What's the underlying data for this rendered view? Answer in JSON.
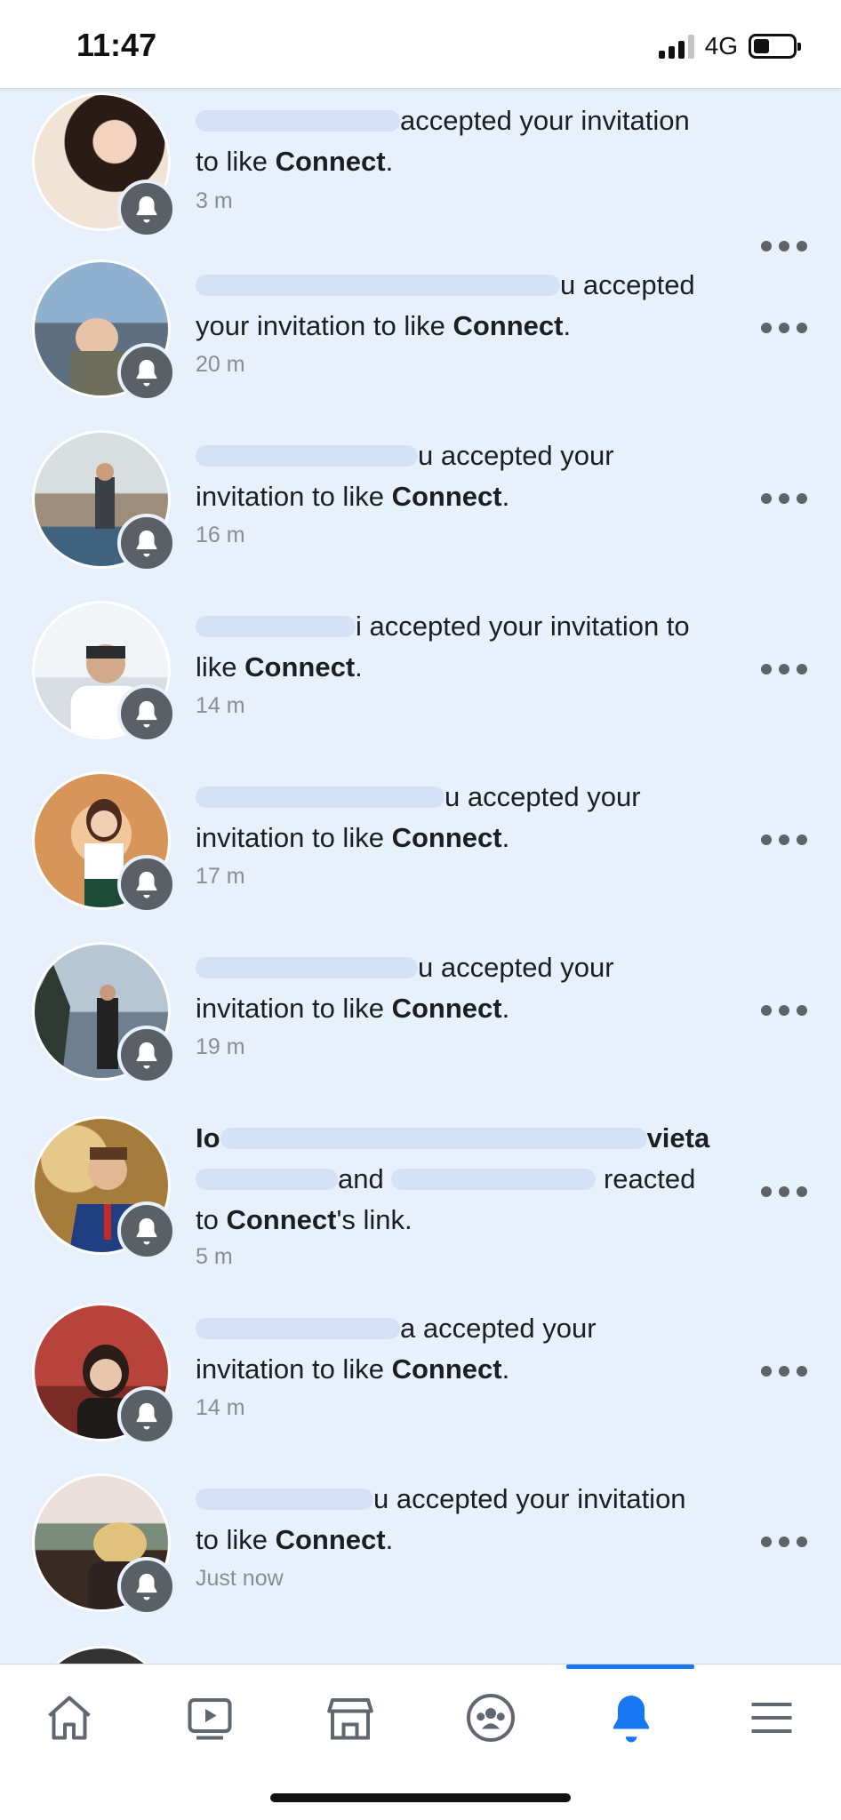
{
  "status_bar": {
    "time": "11:47",
    "network": "4G",
    "signal_bars_active": 3,
    "battery_level": 0.4
  },
  "notifications": [
    {
      "text": "accepted your invitation to like",
      "page": "Connect",
      "suffix": ".",
      "time": "3 m",
      "avatar_bg": [
        "#f3b39c",
        "#2b1b16"
      ]
    },
    {
      "text": "accepted your invitation to like",
      "page": "Connect",
      "suffix": ".",
      "time": "20 m",
      "avatar_bg": [
        "#6f93b3",
        "#3c5366"
      ]
    },
    {
      "text": "accepted your invitation to like",
      "page": "Connect",
      "suffix": ".",
      "time": "16 m",
      "avatar_bg": [
        "#c9d3d8",
        "#7a6a58"
      ]
    },
    {
      "text": "accepted your invitation to",
      "page": "Connect",
      "prefix_before_page": "like ",
      "suffix": ".",
      "time": "14 m",
      "avatar_bg": [
        "#e9eef2",
        "#3e3f44"
      ]
    },
    {
      "text": "accepted your invitation to like",
      "page": "Connect",
      "suffix": ".",
      "time": "17 m",
      "avatar_bg": [
        "#e3b27e",
        "#2d4d3a"
      ]
    },
    {
      "text": "accepted your invitation to like",
      "page": "Connect",
      "suffix": ".",
      "time": "19 m",
      "avatar_bg": [
        "#a6b8c8",
        "#2c2f33"
      ]
    },
    {
      "text_multi": true,
      "line1": "Ioana",
      "line1_end": "vieta",
      "line2_mid": "and",
      "line2_end": "reacted",
      "line3_pre": "to",
      "page": "Connect",
      "suffix": "'s link.",
      "time": "5 m",
      "avatar_bg": [
        "#c7a15c",
        "#1f3a6b"
      ]
    },
    {
      "text": "accepted your invitation to like",
      "page": "Connect",
      "suffix": ".",
      "time": "14 m",
      "avatar_bg": [
        "#b2413a",
        "#2b2522"
      ]
    },
    {
      "text": "accepted your invitation to like",
      "page": "Connect",
      "suffix": ".",
      "time": "Just now",
      "avatar_bg": [
        "#d9c8c0",
        "#3d2a26"
      ]
    }
  ],
  "notification_texts": {
    "n0_l1": "accepted your invitation",
    "n0_l2": "to like ",
    "n0_page": "Connect",
    "n0_end": ".",
    "n1_l1": "u accepted",
    "n1_l2": "your invitation to like ",
    "n1_page": "Connect",
    "n1_end": ".",
    "n2_l1": "u accepted your",
    "n2_l2": "invitation to like ",
    "n2_page": "Connect",
    "n2_end": ".",
    "n3_l1": "i accepted your invitation to",
    "n3_l2": "like ",
    "n3_page": "Connect",
    "n3_end": ".",
    "n4_l1": "u accepted your",
    "n4_l2": "invitation to like ",
    "n4_page": "Connect",
    "n4_end": ".",
    "n5_l1": "u accepted your",
    "n5_l2": "invitation to like ",
    "n5_page": "Connect",
    "n5_end": ".",
    "n6_l1_a": "Io",
    "n6_l1_b": "vieta",
    "n6_l2_a": "and",
    "n6_l2_b": "reacted",
    "n6_l3_a": "to ",
    "n6_page": "Connect",
    "n6_end": "'s link.",
    "n7_l1": "a accepted your",
    "n7_l2": "invitation to like ",
    "n7_page": "Connect",
    "n7_end": ".",
    "n8_l1": "u accepted your invitation",
    "n8_l2": "to like ",
    "n8_page": "Connect",
    "n8_end": "."
  },
  "tab_bar": {
    "active_tab": "notifications",
    "tabs": [
      "home-icon",
      "watch-icon",
      "marketplace-icon",
      "groups-icon",
      "notifications-bell-icon",
      "menu-icon"
    ]
  },
  "colors": {
    "accent": "#1877f2",
    "feed_bg": "#e7f0fb",
    "muted_text": "#8a8d91",
    "badge_bg": "#5b5f66"
  }
}
